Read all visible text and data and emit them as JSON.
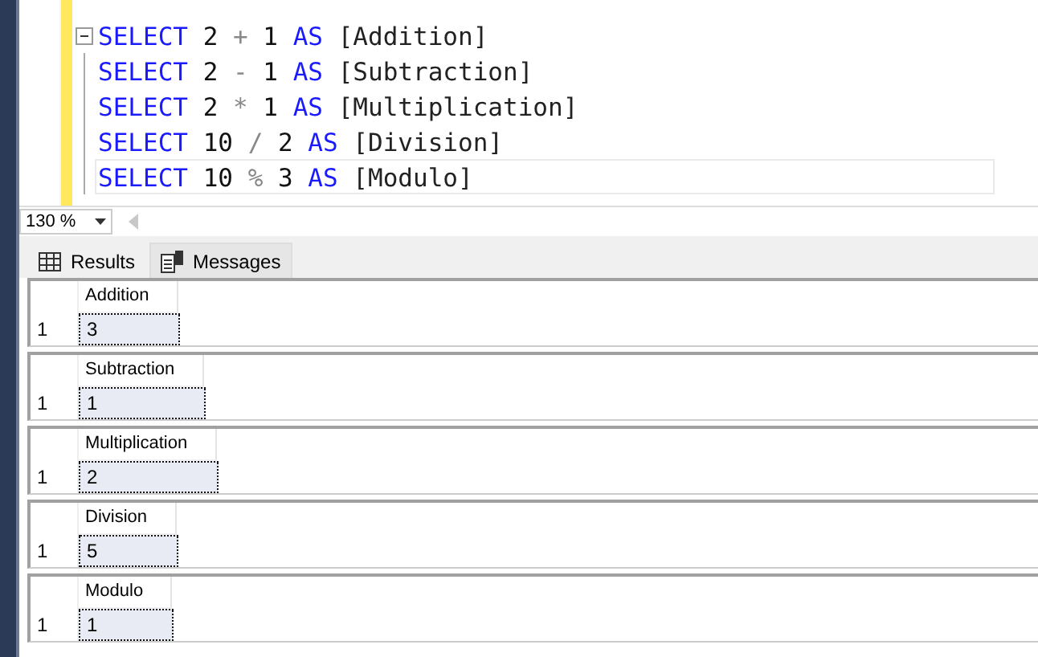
{
  "editor": {
    "lines": [
      {
        "collapsible": true,
        "current": false,
        "tokens": [
          {
            "kind": "keyword",
            "text": "SELECT"
          },
          {
            "kind": "number",
            "text": "2"
          },
          {
            "kind": "operator",
            "text": "+"
          },
          {
            "kind": "number",
            "text": "1"
          },
          {
            "kind": "keyword",
            "text": "AS"
          },
          {
            "kind": "identifier",
            "text": "[Addition]"
          }
        ]
      },
      {
        "collapsible": false,
        "current": false,
        "tokens": [
          {
            "kind": "keyword",
            "text": "SELECT"
          },
          {
            "kind": "number",
            "text": "2"
          },
          {
            "kind": "operator",
            "text": "-"
          },
          {
            "kind": "number",
            "text": "1"
          },
          {
            "kind": "keyword",
            "text": "AS"
          },
          {
            "kind": "identifier",
            "text": "[Subtraction]"
          }
        ]
      },
      {
        "collapsible": false,
        "current": false,
        "tokens": [
          {
            "kind": "keyword",
            "text": "SELECT"
          },
          {
            "kind": "number",
            "text": "2"
          },
          {
            "kind": "operator",
            "text": "*"
          },
          {
            "kind": "number",
            "text": "1"
          },
          {
            "kind": "keyword",
            "text": "AS"
          },
          {
            "kind": "identifier",
            "text": "[Multiplication]"
          }
        ]
      },
      {
        "collapsible": false,
        "current": false,
        "tokens": [
          {
            "kind": "keyword",
            "text": "SELECT"
          },
          {
            "kind": "number",
            "text": "10"
          },
          {
            "kind": "operator",
            "text": "/"
          },
          {
            "kind": "number",
            "text": "2"
          },
          {
            "kind": "keyword",
            "text": "AS"
          },
          {
            "kind": "identifier",
            "text": "[Division]"
          }
        ]
      },
      {
        "collapsible": false,
        "current": true,
        "tokens": [
          {
            "kind": "keyword",
            "text": "SELECT"
          },
          {
            "kind": "number",
            "text": "10"
          },
          {
            "kind": "operator",
            "text": "%"
          },
          {
            "kind": "number",
            "text": "3"
          },
          {
            "kind": "keyword",
            "text": "AS"
          },
          {
            "kind": "identifier",
            "text": "[Modulo]"
          }
        ]
      }
    ]
  },
  "zoom": {
    "value": "130 %"
  },
  "tabs": [
    {
      "label": "Results",
      "selected": true
    },
    {
      "label": "Messages",
      "selected": false
    }
  ],
  "results": [
    {
      "column": "Addition",
      "row_number": "1",
      "value": "3",
      "selected": true
    },
    {
      "column": "Subtraction",
      "row_number": "1",
      "value": "1",
      "selected": true
    },
    {
      "column": "Multiplication",
      "row_number": "1",
      "value": "2",
      "selected": true
    },
    {
      "column": "Division",
      "row_number": "1",
      "value": "5",
      "selected": true
    },
    {
      "column": "Modulo",
      "row_number": "1",
      "value": "1",
      "selected": true
    }
  ]
}
